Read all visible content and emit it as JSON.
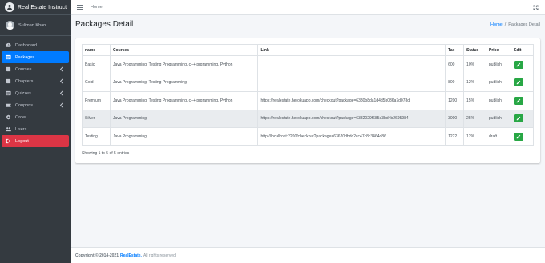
{
  "app": {
    "brand": "Real Estate Instruct"
  },
  "user": {
    "name": "Suliman Khan"
  },
  "sidebar": {
    "items": [
      {
        "label": "Dashboard",
        "icon": "dashboard-icon"
      },
      {
        "label": "Packages",
        "icon": "list-icon",
        "active": true
      },
      {
        "label": "Courses",
        "icon": "book-icon"
      },
      {
        "label": "Chapters",
        "icon": "book-icon"
      },
      {
        "label": "Quizzes",
        "icon": "list-icon"
      },
      {
        "label": "Coupons",
        "icon": "coupon-icon"
      },
      {
        "label": "Order",
        "icon": "cog-icon"
      },
      {
        "label": "Users",
        "icon": "users-icon"
      },
      {
        "label": "Logout",
        "icon": "logout-icon"
      }
    ]
  },
  "topbar": {
    "home": "Home"
  },
  "header": {
    "title": "Packages Detail",
    "breadcrumb": {
      "home": "Home",
      "sep": "/",
      "current": "Packages Detail"
    }
  },
  "table": {
    "columns": [
      "name",
      "Courses",
      "Link",
      "Tax",
      "Status",
      "Price",
      "Edit"
    ],
    "rows": [
      {
        "name": "Basic",
        "courses": "Java Programming, Testing Programming, c++ prgramming, Python",
        "link": "",
        "tax": "600",
        "status": "10%",
        "price": "publish"
      },
      {
        "name": "Gold",
        "courses": "Java Programming, Testing Programming",
        "link": "",
        "tax": "800",
        "status": "12%",
        "price": "publish"
      },
      {
        "name": "Premium",
        "courses": "Java Programming, Testing Programming, c++ prgramming, Python",
        "link": "https://realestate.herokuapp.com/checkout?package=6380b8da1d4d5b036a7d078d",
        "tax": "1200",
        "status": "15%",
        "price": "publish"
      },
      {
        "name": "Silver",
        "courses": "Java Programming",
        "link": "https://realestate.herokuapp.com/checkout?package=6382029f685e3bd4b2695984",
        "tax": "3000",
        "status": "25%",
        "price": "publish"
      },
      {
        "name": "Testing",
        "courses": "Java Programming",
        "link": "http://localhost:2200/checkout?package=63620dbdd2cc47c8c3464d86",
        "tax": "1222",
        "status": "12%",
        "price": "draft"
      }
    ],
    "showing": "Showing 1 to 5 of 5 entries"
  },
  "footer": {
    "copyright": "Copyright © 2014-2021",
    "brand": "RealEstate.",
    "rights": "All rights reserved."
  },
  "colors": {
    "primary": "#007bff",
    "success": "#28a745",
    "danger": "#dc3545",
    "sidebar": "#343a40"
  }
}
